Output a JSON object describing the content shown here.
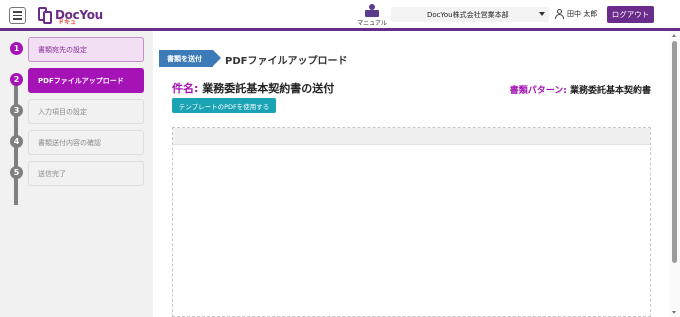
{
  "header": {
    "logo_text": "DocYou",
    "logo_sub": "ドキュ",
    "manual_label": "マニュアル",
    "company_selected": "DocYou株式会社営業本部",
    "user_name": "田中 太郎",
    "logout_label": "ログアウト"
  },
  "sidebar": {
    "steps": [
      {
        "num": "1",
        "label": "書類宛先の設定",
        "state": "done"
      },
      {
        "num": "2",
        "label": "PDFファイルアップロード",
        "state": "active"
      },
      {
        "num": "3",
        "label": "入力項目の設定",
        "state": "todo"
      },
      {
        "num": "4",
        "label": "書類送付内容の確認",
        "state": "todo"
      },
      {
        "num": "5",
        "label": "送信完了",
        "state": "todo"
      }
    ]
  },
  "main": {
    "crumb_tag": "書類を送付",
    "crumb_title": "PDFファイルアップロード",
    "doc_name_label": "件名:",
    "doc_name": "業務委託基本契約書の送付",
    "pattern_label": "書類パターン:",
    "pattern": "業務委託基本契約書",
    "use_template_button": "テンプレートのPDFを使用する"
  },
  "colors": {
    "brand": "#6a2c8a",
    "active_step": "#a512b5",
    "step_done_circle": "#a512b5",
    "step_todo_circle": "#7f7f7f",
    "crumb_tag": "#3d7ab8",
    "template_button": "#1aa3b4"
  },
  "icons": {
    "menu": "hamburger-icon",
    "manual": "manual-book-icon",
    "user": "user-icon",
    "dropdown": "chevron-down-icon"
  }
}
